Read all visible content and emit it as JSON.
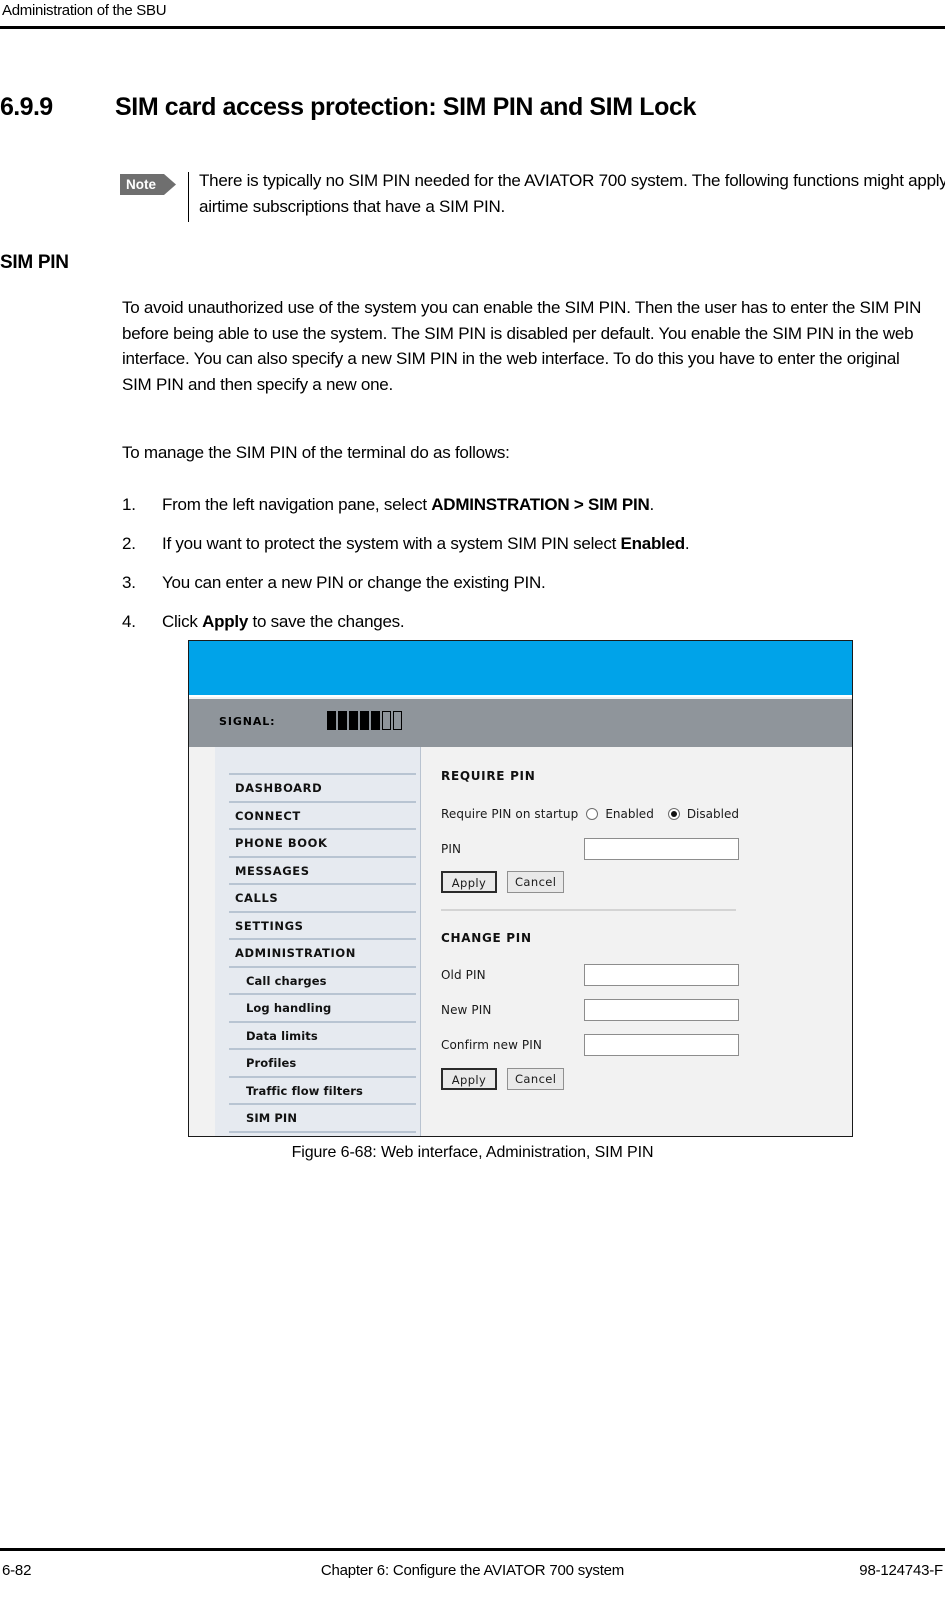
{
  "page_header": {
    "running_head": "Administration of the SBU"
  },
  "section": {
    "number": "6.9.9",
    "title": "SIM card access protection: SIM PIN and SIM Lock"
  },
  "note": {
    "tag": "Note",
    "text": "There is typically no SIM PIN needed for the AVIATOR 700 system. The following functions might apply for special airtime subscriptions that have a SIM PIN."
  },
  "subhead": "SIM PIN",
  "paragraphs": {
    "p1": "To avoid unauthorized use of the system you can enable the SIM PIN. Then the user has to enter the SIM PIN before being able to use the system. The SIM PIN is disabled per default. You enable the SIM PIN in the web interface. You can also specify a new SIM PIN in the web interface. To do this you have to enter the original SIM PIN and then specify a new one.",
    "p2": "To manage the SIM PIN of the terminal do as follows:"
  },
  "steps": [
    {
      "num": "1.",
      "pre": "From the left navigation pane, select ",
      "bold": "ADMINSTRATION > SIM PIN",
      "post": "."
    },
    {
      "num": "2.",
      "pre": "If you want to protect the system with a system SIM PIN select ",
      "bold": "Enabled",
      "post": "."
    },
    {
      "num": "3.",
      "pre": "You can enter a new PIN or change the existing PIN.",
      "bold": "",
      "post": ""
    },
    {
      "num": "4.",
      "pre": "Click ",
      "bold": "Apply",
      "post": " to save the changes."
    }
  ],
  "figure": {
    "caption": "Figure 6-68: Web interface, Administration, SIM PIN",
    "colors": {
      "topbar_blue": "#00a3e9",
      "signalbar_gray": "#8f959b",
      "nav_background": "#e6eaf0",
      "nav_separator": "#b8c4d2",
      "content_background": "#f2f2f2"
    },
    "statusbar": {
      "signal_label": "SIGNAL:",
      "signal_bars_total": 7,
      "signal_bars_filled": 5
    },
    "nav_items": [
      {
        "label": "DASHBOARD",
        "level": "top"
      },
      {
        "label": "CONNECT",
        "level": "top"
      },
      {
        "label": "PHONE BOOK",
        "level": "top"
      },
      {
        "label": "MESSAGES",
        "level": "top"
      },
      {
        "label": "CALLS",
        "level": "top"
      },
      {
        "label": "SETTINGS",
        "level": "top"
      },
      {
        "label": "ADMINISTRATION",
        "level": "top"
      },
      {
        "label": "Call charges",
        "level": "sub"
      },
      {
        "label": "Log handling",
        "level": "sub"
      },
      {
        "label": "Data limits",
        "level": "sub"
      },
      {
        "label": "Profiles",
        "level": "sub"
      },
      {
        "label": "Traffic flow filters",
        "level": "sub"
      },
      {
        "label": "SIM PIN",
        "level": "sub"
      }
    ],
    "require_pin": {
      "heading": "REQUIRE PIN",
      "startup_label": "Require PIN on startup",
      "option_enabled": "Enabled",
      "option_disabled": "Disabled",
      "selected_option": "Disabled",
      "pin_label": "PIN",
      "pin_value": "",
      "apply_label": "Apply",
      "cancel_label": "Cancel"
    },
    "change_pin": {
      "heading": "CHANGE PIN",
      "old_pin_label": "Old PIN",
      "old_pin_value": "",
      "new_pin_label": "New PIN",
      "new_pin_value": "",
      "confirm_pin_label": "Confirm new PIN",
      "confirm_pin_value": "",
      "apply_label": "Apply",
      "cancel_label": "Cancel"
    }
  },
  "footer": {
    "page_number": "6-82",
    "chapter": "Chapter 6:  Configure the AVIATOR 700 system",
    "doc_number": "98-124743-F"
  }
}
